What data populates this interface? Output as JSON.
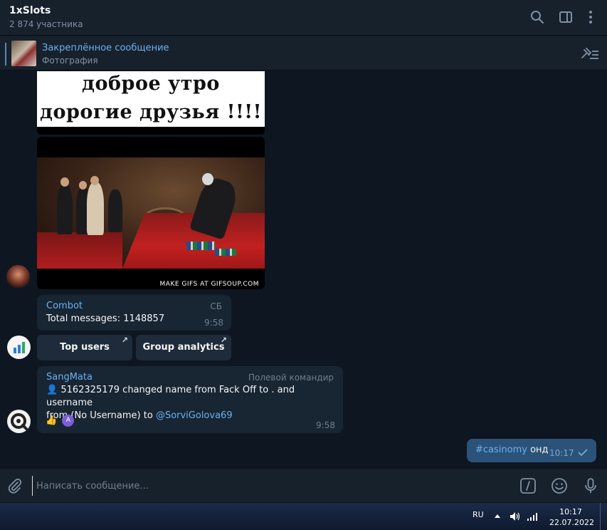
{
  "header": {
    "title": "1xSlots",
    "subtitle": "2 874 участника",
    "icons": [
      "search-icon",
      "sidebar-toggle-icon",
      "more-vertical-icon"
    ]
  },
  "pinned": {
    "title": "Закреплённое сообщение",
    "subtitle": "Фотография",
    "icon": "unpin-list-icon"
  },
  "messages": {
    "gif_greeting": {
      "line1": "доброе утро",
      "line2": "дорогие друзья !!!!"
    },
    "gif_casino": {
      "caption": "MAKE GIFS AT GIFSOUP.COM"
    },
    "combot": {
      "author": "Combot",
      "text": "Total messages: 1148857",
      "badge": "СБ",
      "time": "9:58",
      "buttons": [
        {
          "label": "Top users",
          "icon": "external-arrow-icon"
        },
        {
          "label": "Group analytics",
          "icon": "external-arrow-icon"
        }
      ]
    },
    "sangmata": {
      "author": "SangMata",
      "badge": "Полевой командир",
      "icon": "user-silhouette-icon",
      "text_line1": "5162325179 changed name from Fack Off to . and username",
      "text_line2_prefix": "from (No Username) to ",
      "mention": "@SorviGolova69",
      "reaction_emoji": "👍",
      "reaction_avatar": "A",
      "time": "9:58"
    },
    "outgoing": {
      "hashtag": "#casinomy",
      "text": " онд",
      "time": "10:17",
      "status_icon": "single-check-icon"
    }
  },
  "composer": {
    "placeholder": "Написать сообщение...",
    "icons": [
      "attach-icon",
      "bot-command-icon",
      "emoji-icon",
      "microphone-icon"
    ]
  },
  "taskbar": {
    "language": "RU",
    "time": "10:17",
    "date": "22.07.2022",
    "icons": [
      "tray-up-icon",
      "volume-icon",
      "network-signal-icon"
    ]
  },
  "colors": {
    "background": "#0e1621",
    "panel": "#17212b",
    "incoming_bubble": "#182533",
    "outgoing_bubble": "#2b5278",
    "accent": "#6ab2f2"
  }
}
